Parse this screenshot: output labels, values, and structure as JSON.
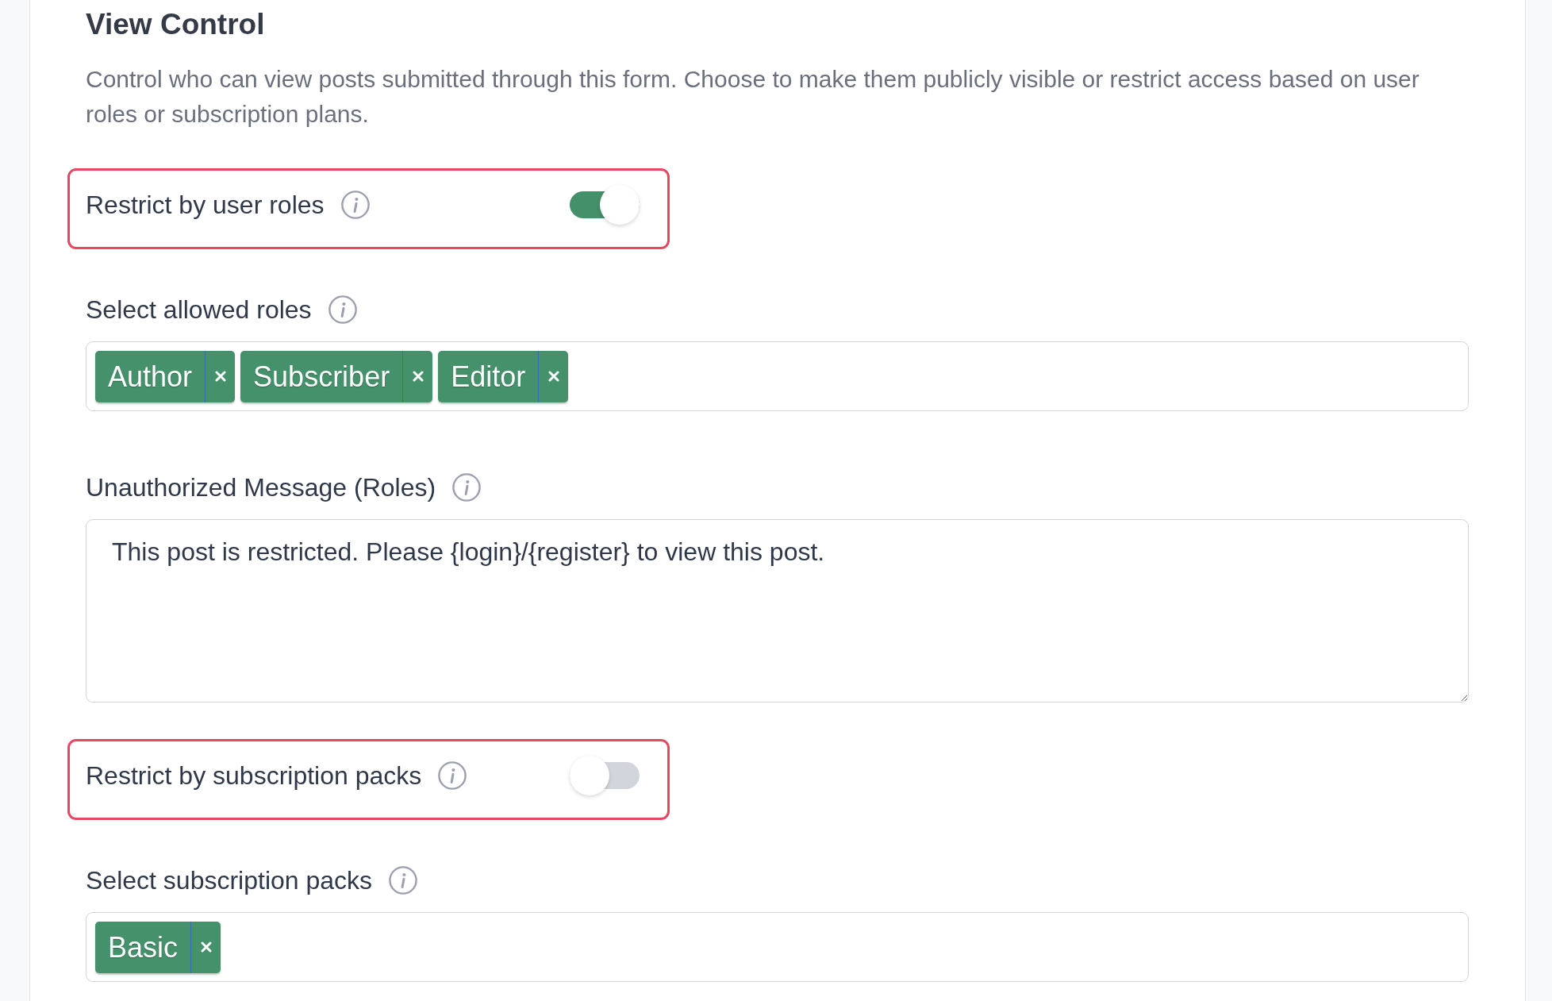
{
  "section": {
    "title": "View Control",
    "description": "Control who can view posts submitted through this form. Choose to make them publicly visible or restrict access based on user roles or subscription plans."
  },
  "fields": [
    {
      "kind": "toggle",
      "label": "Restrict by user roles",
      "on": true,
      "highlighted": true
    },
    {
      "kind": "tags",
      "label": "Select allowed roles",
      "tags": [
        "Author",
        "Subscriber",
        "Editor"
      ]
    },
    {
      "kind": "textarea",
      "label": "Unauthorized Message (Roles)",
      "value": "This post is restricted. Please {login}/{register} to view this post."
    },
    {
      "kind": "toggle",
      "label": "Restrict by subscription packs",
      "on": false,
      "highlighted": true
    },
    {
      "kind": "tags",
      "label": "Select subscription packs",
      "tags": [
        "Basic"
      ]
    }
  ]
}
